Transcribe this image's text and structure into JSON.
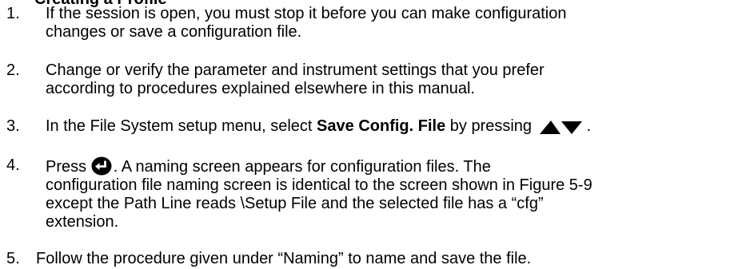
{
  "heading": "Creating a Profile",
  "steps": [
    {
      "number": "1.",
      "lines": [
        "If the session is open, you must stop it before you can make configuration",
        "changes or save a configuration file."
      ]
    },
    {
      "number": "2.",
      "lines": [
        "Change or verify the parameter and instrument settings that you prefer",
        "according to procedures explained elsewhere in this manual."
      ]
    },
    {
      "number": "3.",
      "before": "In the File System setup menu, select ",
      "bold": "Save Config. File",
      "after": " by pressing",
      "icon": "up-down-arrows-icon",
      "end": "."
    },
    {
      "number": "4.",
      "before": "Press ",
      "icon": "enter-return-icon",
      "after": ". A naming screen appears for configuration files. The",
      "lines": [
        "configuration file naming screen is identical to the screen shown in Figure 5-9",
        "except the Path Line reads \\Setup File and the selected file has a “cfg”",
        "extension."
      ]
    },
    {
      "number": "5.",
      "lines": [
        "Follow the procedure given under “Naming” to name and  save the file."
      ]
    }
  ]
}
